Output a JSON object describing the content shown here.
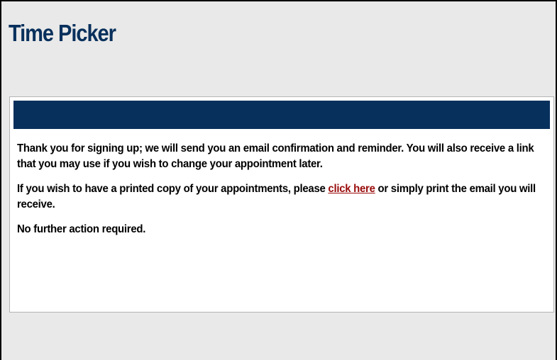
{
  "page": {
    "title": "Time Picker"
  },
  "confirmation": {
    "paragraph1": "Thank you for signing up; we will send you an email confirmation and reminder. You will also receive a link that you may use if you wish to change your appointment later.",
    "paragraph2_before": "If you wish to have a printed copy of your appointments, please ",
    "paragraph2_link": "click here",
    "paragraph2_after": " or simply print the email you will receive.",
    "paragraph3": "No further action required."
  },
  "colors": {
    "header_bar": "#08305c",
    "title": "#08305c",
    "link": "#9a0b0b",
    "background": "#e9e9e9"
  }
}
